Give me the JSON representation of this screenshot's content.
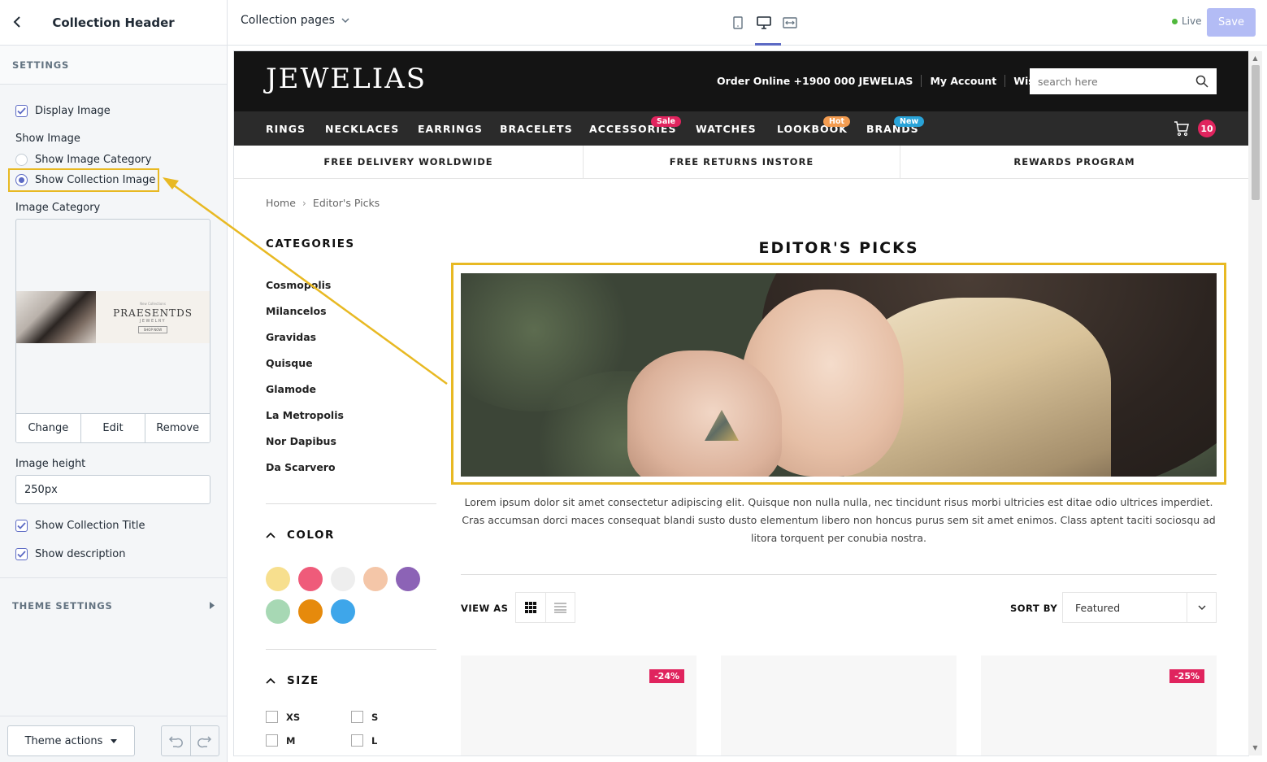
{
  "sidebar": {
    "title": "Collection Header",
    "section_title": "SETTINGS",
    "display_image_label": "Display Image",
    "show_image_label": "Show Image",
    "option_category": "Show Image Category",
    "option_collection": "Show Collection Image",
    "selected_option": "Show Collection Image",
    "image_category_label": "Image Category",
    "thumb": {
      "small": "New Collections",
      "big": "PRAESENTDS",
      "sub": "JEWELRY",
      "button": "SHOP NOW"
    },
    "buttons": {
      "change": "Change",
      "edit": "Edit",
      "remove": "Remove"
    },
    "image_height_label": "Image height",
    "image_height_value": "250px",
    "show_collection_title_label": "Show Collection Title",
    "show_description_label": "Show description",
    "theme_settings_label": "THEME SETTINGS",
    "theme_actions_label": "Theme actions"
  },
  "topbar": {
    "page_select": "Collection pages",
    "live_label": "Live",
    "save_label": "Save"
  },
  "store": {
    "logo": "JEWELIAS",
    "top_links": [
      "Order Online +1900 000 JEWELIAS",
      "My Account",
      "Wish Lists"
    ],
    "search_placeholder": "search here",
    "nav": [
      {
        "label": "RINGS",
        "badge": null
      },
      {
        "label": "NECKLACES",
        "badge": null
      },
      {
        "label": "EARRINGS",
        "badge": null
      },
      {
        "label": "BRACELETS",
        "badge": null
      },
      {
        "label": "ACCESSORIES",
        "badge": "Sale"
      },
      {
        "label": "WATCHES",
        "badge": null
      },
      {
        "label": "LOOKBOOK",
        "badge": "Hot"
      },
      {
        "label": "BRANDS",
        "badge": "New"
      }
    ],
    "cart_count": "10",
    "promos": [
      "FREE DELIVERY WORLDWIDE",
      "FREE RETURNS INSTORE",
      "REWARDS PROGRAM"
    ],
    "breadcrumb": [
      "Home",
      "Editor's Picks"
    ],
    "categories_title": "CATEGORIES",
    "categories": [
      "Cosmopolis",
      "Milancelos",
      "Gravidas",
      "Quisque",
      "Glamode",
      "La Metropolis",
      "Nor Dapibus",
      "Da Scarvero"
    ],
    "color_title": "COLOR",
    "colors": [
      "#f7df8e",
      "#ef5b7a",
      "#eeeeee",
      "#f4c6a8",
      "#8c63b6",
      "#a7d8b4",
      "#e68a0c",
      "#3ea6ea"
    ],
    "size_title": "SIZE",
    "sizes": [
      "XS",
      "S",
      "M",
      "L"
    ],
    "collection_title": "EDITOR'S PICKS",
    "description": "Lorem ipsum dolor sit amet consectetur adipiscing elit. Quisque non nulla nulla, nec tincidunt risus morbi ultricies est ditae odio ultrices imperdiet. Cras accumsan dorci maces consequat blandi susto dusto elementum libero non honcus purus sem sit amet enimos. Class aptent taciti sociosqu ad litora torquent per conubia nostra.",
    "view_as_label": "VIEW AS",
    "sort_by_label": "SORT BY",
    "sort_value": "Featured",
    "products": [
      {
        "discount": "-24%"
      },
      {
        "discount": ""
      },
      {
        "discount": "-25%"
      }
    ]
  },
  "colors": {
    "accent": "#5c6ac4",
    "highlight": "#e8b923",
    "save_disabled": "#b3bcf5",
    "badge_sale": "#e0245e",
    "badge_hot": "#f39c50",
    "badge_new": "#29a3d8"
  },
  "icons": {
    "back": "chevron-left-icon",
    "dropdown": "chevron-down-icon",
    "mobile": "mobile-icon",
    "desktop": "desktop-icon",
    "fullscreen": "fullscreen-icon",
    "search": "search-icon",
    "cart": "cart-icon",
    "grid": "grid-icon",
    "list": "list-icon",
    "undo": "undo-icon",
    "redo": "redo-icon"
  }
}
